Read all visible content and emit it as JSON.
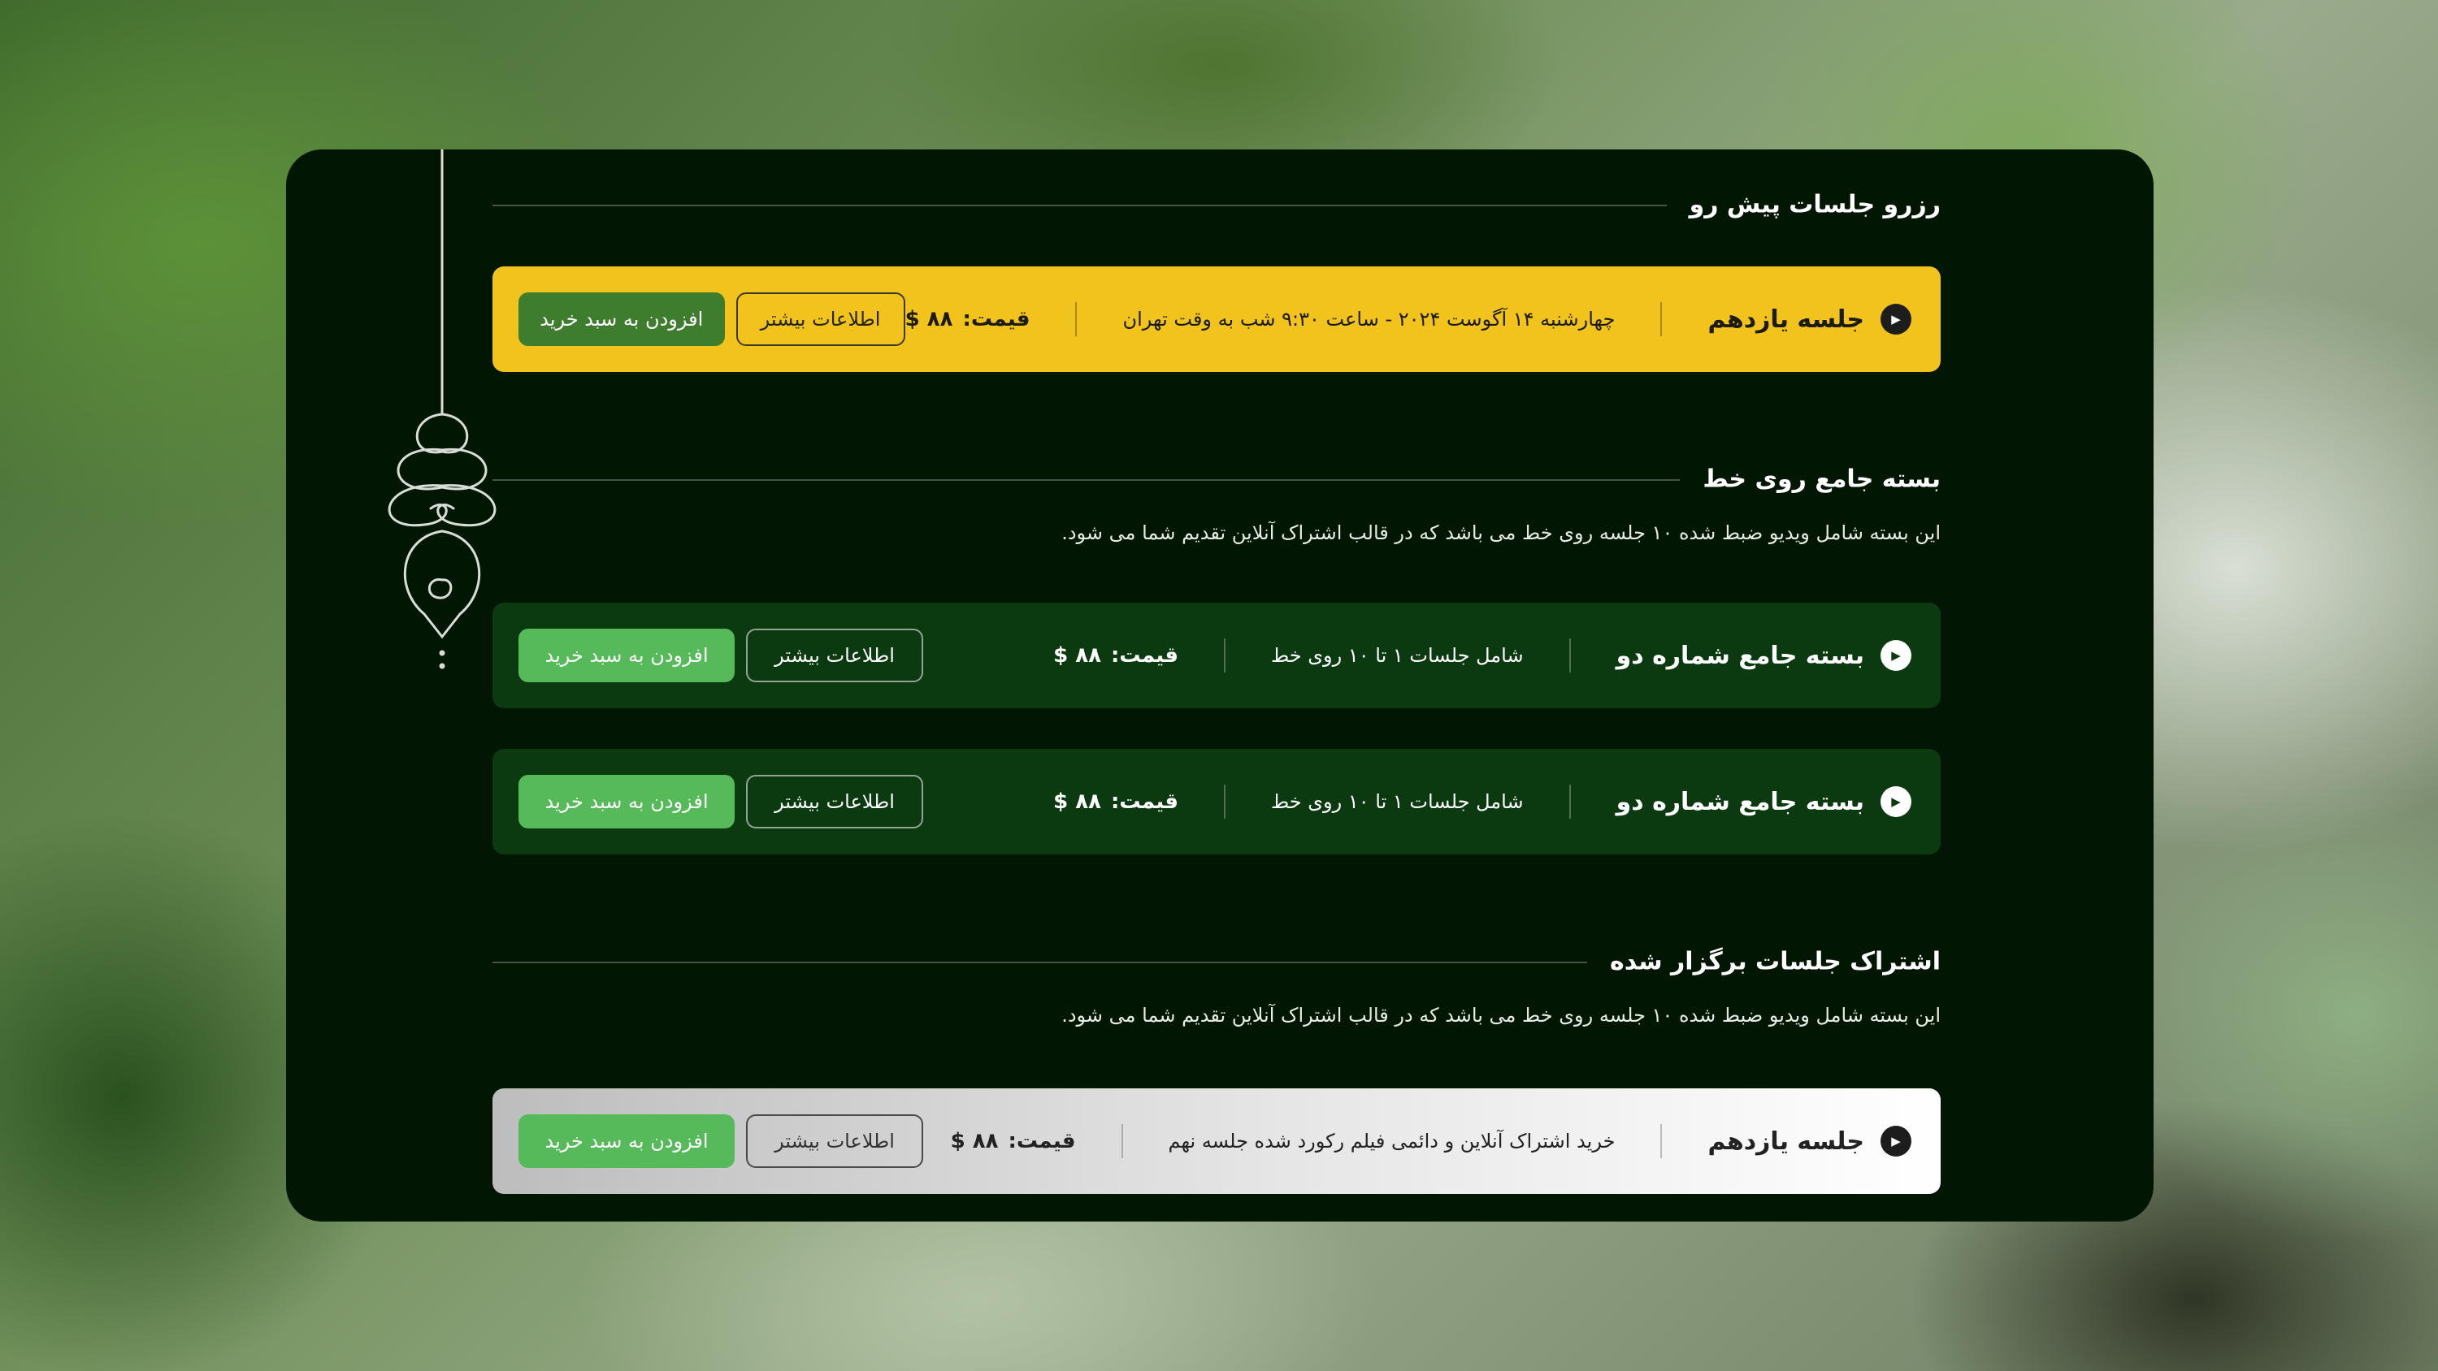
{
  "colors": {
    "panel_bg": "#021604",
    "yellow_card": "#f1c31c",
    "green_card": "#0b3a10",
    "cart_button_dark": "#3e7d2e",
    "cart_button_light": "#56b95a"
  },
  "sections": [
    {
      "title": "رزرو جلسات پیش رو",
      "items": [
        {
          "title": "جلسه یازدهم",
          "desc": "چهارشنبه ۱۴ آگوست ۲۰۲۴ - ساعت ۹:۳۰ شب به وقت تهران",
          "price_label": "قیمت:",
          "price_value": "$ ۸۸",
          "info_label": "اطلاعات بیشتر",
          "cart_label": "افزودن به سبد خرید",
          "icon": "play-icon"
        }
      ]
    },
    {
      "title": "بسته جامع روی خط",
      "desc": "این بسته شامل ویدیو ضبط شده ۱۰ جلسه روی خط می باشد که در قالب اشتراک آنلاین تقدیم شما می شود.",
      "items": [
        {
          "title": "بسته جامع شماره دو",
          "desc": "شامل جلسات ۱ تا ۱۰ روی خط",
          "price_label": "قیمت:",
          "price_value": "$ ۸۸",
          "info_label": "اطلاعات بیشتر",
          "cart_label": "افزودن به سبد خرید",
          "icon": "play-icon"
        },
        {
          "title": "بسته جامع شماره دو",
          "desc": "شامل جلسات ۱ تا ۱۰ روی خط",
          "price_label": "قیمت:",
          "price_value": "$ ۸۸",
          "info_label": "اطلاعات بیشتر",
          "cart_label": "افزودن به سبد خرید",
          "icon": "play-icon"
        }
      ]
    },
    {
      "title": "اشتراک جلسات برگزار شده",
      "desc": "این بسته شامل ویدیو ضبط شده ۱۰ جلسه روی خط می باشد که در قالب اشتراک آنلاین تقدیم شما می شود.",
      "items": [
        {
          "title": "جلسه یازدهم",
          "desc": "خرید اشتراک آنلاین و دائمی فیلم رکورد شده جلسه نهم",
          "price_label": "قیمت:",
          "price_value": "$ ۸۸",
          "info_label": "اطلاعات بیشتر",
          "cart_label": "افزودن به سبد خرید",
          "icon": "play-icon"
        }
      ]
    }
  ]
}
